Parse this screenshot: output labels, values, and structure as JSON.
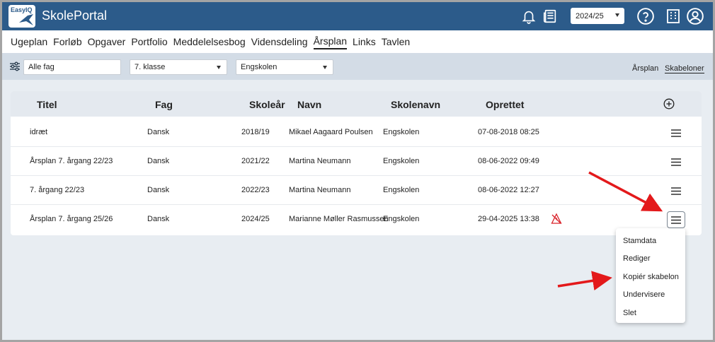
{
  "header": {
    "logo_text": "EasyIQ",
    "app_title": "SkolePortal",
    "school_year": "2024/25"
  },
  "nav": {
    "items": [
      "Ugeplan",
      "Forløb",
      "Opgaver",
      "Portfolio",
      "Meddelelsesbog",
      "Vidensdeling",
      "Årsplan",
      "Links",
      "Tavlen"
    ],
    "active": "Årsplan"
  },
  "filters": {
    "subject_value": "Alle fag",
    "class_value": "7. klasse",
    "school_value": "Engskolen"
  },
  "view_links": {
    "aarsplan": "Årsplan",
    "skabeloner": "Skabeloner"
  },
  "table": {
    "headers": {
      "titel": "Titel",
      "fag": "Fag",
      "skolear": "Skoleår",
      "navn": "Navn",
      "skolenavn": "Skolenavn",
      "oprettet": "Oprettet"
    },
    "rows": [
      {
        "titel": "idræt",
        "fag": "Dansk",
        "skolear": "2018/19",
        "navn": "Mikael Aagaard Poulsen",
        "skolenavn": "Engskolen",
        "oprettet": "07-08-2018 08:25"
      },
      {
        "titel": "Årsplan 7. årgang 22/23",
        "fag": "Dansk",
        "skolear": "2021/22",
        "navn": "Martina Neumann",
        "skolenavn": "Engskolen",
        "oprettet": "08-06-2022 09:49"
      },
      {
        "titel": "7. årgang 22/23",
        "fag": "Dansk",
        "skolear": "2022/23",
        "navn": "Martina Neumann",
        "skolenavn": "Engskolen",
        "oprettet": "08-06-2022 12:27"
      },
      {
        "titel": "Årsplan 7. årgang 25/26",
        "fag": "Dansk",
        "skolear": "2024/25",
        "navn": "Marianne Møller Rasmussen",
        "skolenavn": "Engskolen",
        "oprettet": "29-04-2025 13:38"
      }
    ]
  },
  "row_menu": {
    "items": [
      "Stamdata",
      "Rediger",
      "Kopiér skabelon",
      "Undervisere",
      "Slet"
    ]
  },
  "colors": {
    "header_bg": "#2c5b8a",
    "filterbar_bg": "#d3dce6",
    "arrow": "#e3191b"
  }
}
